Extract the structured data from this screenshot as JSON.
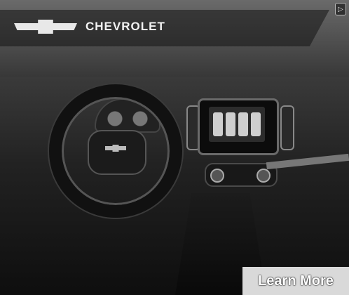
{
  "ad": {
    "brand": "CHEVROLET",
    "cta_label": "Learn More",
    "adchoices_label": "▷"
  },
  "icons": [
    "chevrolet-bowtie-icon",
    "adchoices-icon"
  ]
}
